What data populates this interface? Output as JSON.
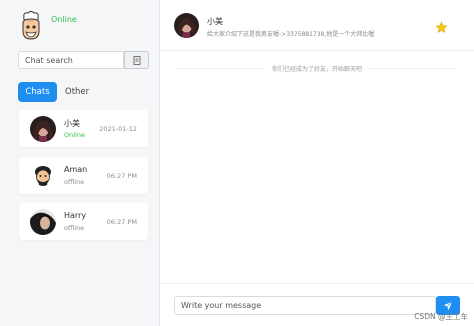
{
  "me": {
    "status": "Online",
    "avatar_icon": "cartoon-chef-avatar-icon"
  },
  "search": {
    "placeholder": "Chat search",
    "icon": "search-icon"
  },
  "tabs": [
    {
      "label": "Chats",
      "active": true
    },
    {
      "label": "Other",
      "active": false
    }
  ],
  "chats": [
    {
      "name": "小美",
      "status": "Online",
      "time": "2021-01-12"
    },
    {
      "name": "Aman",
      "status": "offline",
      "time": "06:27 PM"
    },
    {
      "name": "Harry",
      "status": "offline",
      "time": "06:27 PM"
    }
  ],
  "header": {
    "name": "小美",
    "description": "给大家介绍下这是我男友喔->3375881738,他是一个大帅比喔",
    "star_icon": "star-icon"
  },
  "system_note": "你们已经成为了好友，开始聊天吧",
  "composer": {
    "placeholder": "Write your message",
    "send_icon": "send-icon"
  },
  "watermark": "CSDN @王工车",
  "colors": {
    "accent": "#1f8ef1",
    "online": "#2fbf4f",
    "star": "#f5c518"
  }
}
